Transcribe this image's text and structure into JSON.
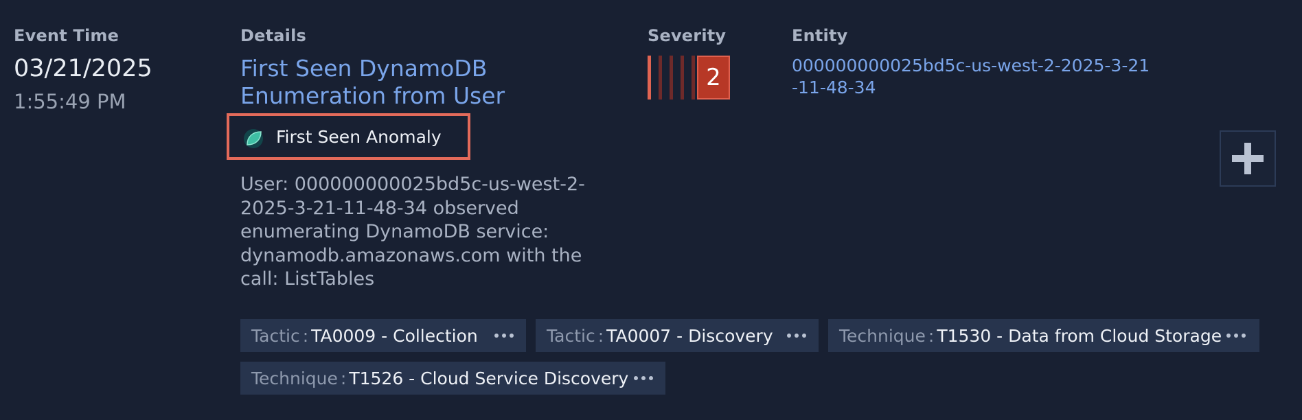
{
  "columns": {
    "event_time": "Event Time",
    "details": "Details",
    "severity": "Severity",
    "entity": "Entity"
  },
  "event": {
    "date": "03/21/2025",
    "time": "1:55:49 PM"
  },
  "details": {
    "title": "First Seen DynamoDB Enumeration from User",
    "anomaly_label": "First Seen Anomaly",
    "description": "User: 000000000025bd5c-us-west-2-2025-3-21-11-48-34 observed enumerating DynamoDB service: dynamodb.amazonaws.com with the call: ListTables"
  },
  "severity": {
    "value": "2",
    "bar_colors": [
      "#e06452",
      "#6e2a2a",
      "#6e2a2a",
      "#6e2a2a",
      "#6e2a2a"
    ],
    "badge_color": "#b73826"
  },
  "entity": {
    "value": "000000000025bd5c-us-west-2-2025-3-21-11-48-34"
  },
  "actions": {
    "add_icon": "plus-icon"
  },
  "tags": [
    {
      "key": "Tactic",
      "value": "TA0009 - Collection"
    },
    {
      "key": "Tactic",
      "value": "TA0007 - Discovery"
    },
    {
      "key": "Technique",
      "value": "T1530 - Data from Cloud Storage"
    },
    {
      "key": "Technique",
      "value": "T1526 - Cloud Service Discovery"
    }
  ],
  "colors": {
    "background": "#182032",
    "link": "#7aa5ea",
    "highlight_border": "#e36a5a",
    "tag_background": "#27344d"
  }
}
